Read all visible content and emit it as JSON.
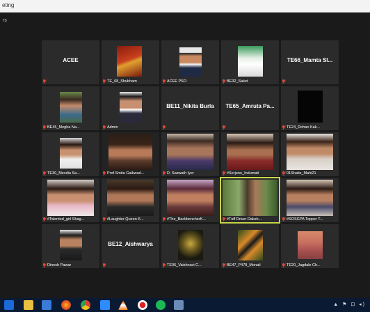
{
  "window": {
    "title": "eting"
  },
  "sidebar_hint": "rs",
  "tiles": [
    {
      "id": "t1",
      "label": "",
      "center_name": "ACEE"
    },
    {
      "id": "t2",
      "label": "TE_68_Shubham",
      "center_name": ""
    },
    {
      "id": "t3",
      "label": "ACEE PSO",
      "center_name": ""
    },
    {
      "id": "t4",
      "label": "BE32_Saket",
      "center_name": ""
    },
    {
      "id": "t5",
      "label": "",
      "center_name": "TE66_Mamta Sl..."
    },
    {
      "id": "t6",
      "label": "BE45_Megha Na...",
      "center_name": ""
    },
    {
      "id": "t7",
      "label": "Admin",
      "center_name": ""
    },
    {
      "id": "t8",
      "label": "",
      "center_name": "BE11_Nikita Burla"
    },
    {
      "id": "t9",
      "label": "",
      "center_name": "TE65_Amruta Pa..."
    },
    {
      "id": "t10",
      "label": "TE24_Rohan Kak...",
      "center_name": ""
    },
    {
      "id": "t11",
      "label": "TE30_Mecdia Sa...",
      "center_name": ""
    },
    {
      "id": "t12",
      "label": "Prof.Smita Gaikwad...",
      "center_name": ""
    },
    {
      "id": "t13",
      "label": "D. Saswath Iyer",
      "center_name": ""
    },
    {
      "id": "t14",
      "label": "#Serjene_Indumati",
      "center_name": ""
    },
    {
      "id": "t15",
      "label": "01Shatiz_Mahi21",
      "center_name": ""
    },
    {
      "id": "t16",
      "label": "#Talented_girl Shag...",
      "center_name": ""
    },
    {
      "id": "t17",
      "label": "#Laughter Queen K...",
      "center_name": ""
    },
    {
      "id": "t18",
      "label": "#The_BackbencherK...",
      "center_name": ""
    },
    {
      "id": "t19",
      "label": "#Tuff Driver Daksh...",
      "center_name": ""
    },
    {
      "id": "t20",
      "label": "#SOSGPA Topper T...",
      "center_name": ""
    },
    {
      "id": "t21",
      "label": "Dinesh Pawar",
      "center_name": ""
    },
    {
      "id": "t22",
      "label": "",
      "center_name": "BE12_Aishwarya"
    },
    {
      "id": "t23",
      "label": "TE06_Vaishnavi C...",
      "center_name": ""
    },
    {
      "id": "t24",
      "label": "BE47_P478_Monali",
      "center_name": ""
    },
    {
      "id": "t25",
      "label": "TE20_Jagdale Ch...",
      "center_name": ""
    }
  ],
  "colors": {
    "background": "#1a1a1a",
    "tile": "#2b2b2b",
    "active_speaker": "#c9d64a",
    "muted_mic": "#e04a3a",
    "taskbar": "#0a1a33"
  },
  "taskbar": {
    "icons": [
      "start-icon",
      "file-explorer-icon",
      "media-icon",
      "firefox-icon",
      "chrome-icon",
      "zoom-icon",
      "vlc-icon",
      "record-icon",
      "spotify-icon",
      "app-icon"
    ],
    "tray_text": "▲ ⚑ ⊡ ◂)"
  }
}
